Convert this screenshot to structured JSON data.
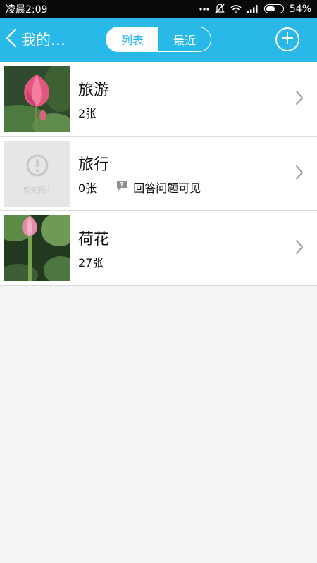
{
  "status_bar": {
    "time": "凌晨2:09",
    "battery_percent": "54%",
    "battery_level": 0.54,
    "icons": [
      "more-dots-icon",
      "bell-muted-icon",
      "wifi-icon",
      "signal-icon",
      "battery-icon"
    ]
  },
  "nav": {
    "back_label": "我的…",
    "tabs": [
      {
        "label": "列表",
        "active": true
      },
      {
        "label": "最近",
        "active": false
      }
    ],
    "add_icon": "plus-circle-icon",
    "accent_color": "#29b9e8"
  },
  "albums": [
    {
      "title": "旅游",
      "count": "2张",
      "thumbnail": "pink-lotus-photo"
    },
    {
      "title": "旅行",
      "count": "0张",
      "thumbnail_text": "暂无照片",
      "hint": "回答问题可见",
      "hint_icon": "question-bubble-icon"
    },
    {
      "title": "荷花",
      "count": "27张",
      "thumbnail": "lotus-bud-photo"
    }
  ]
}
